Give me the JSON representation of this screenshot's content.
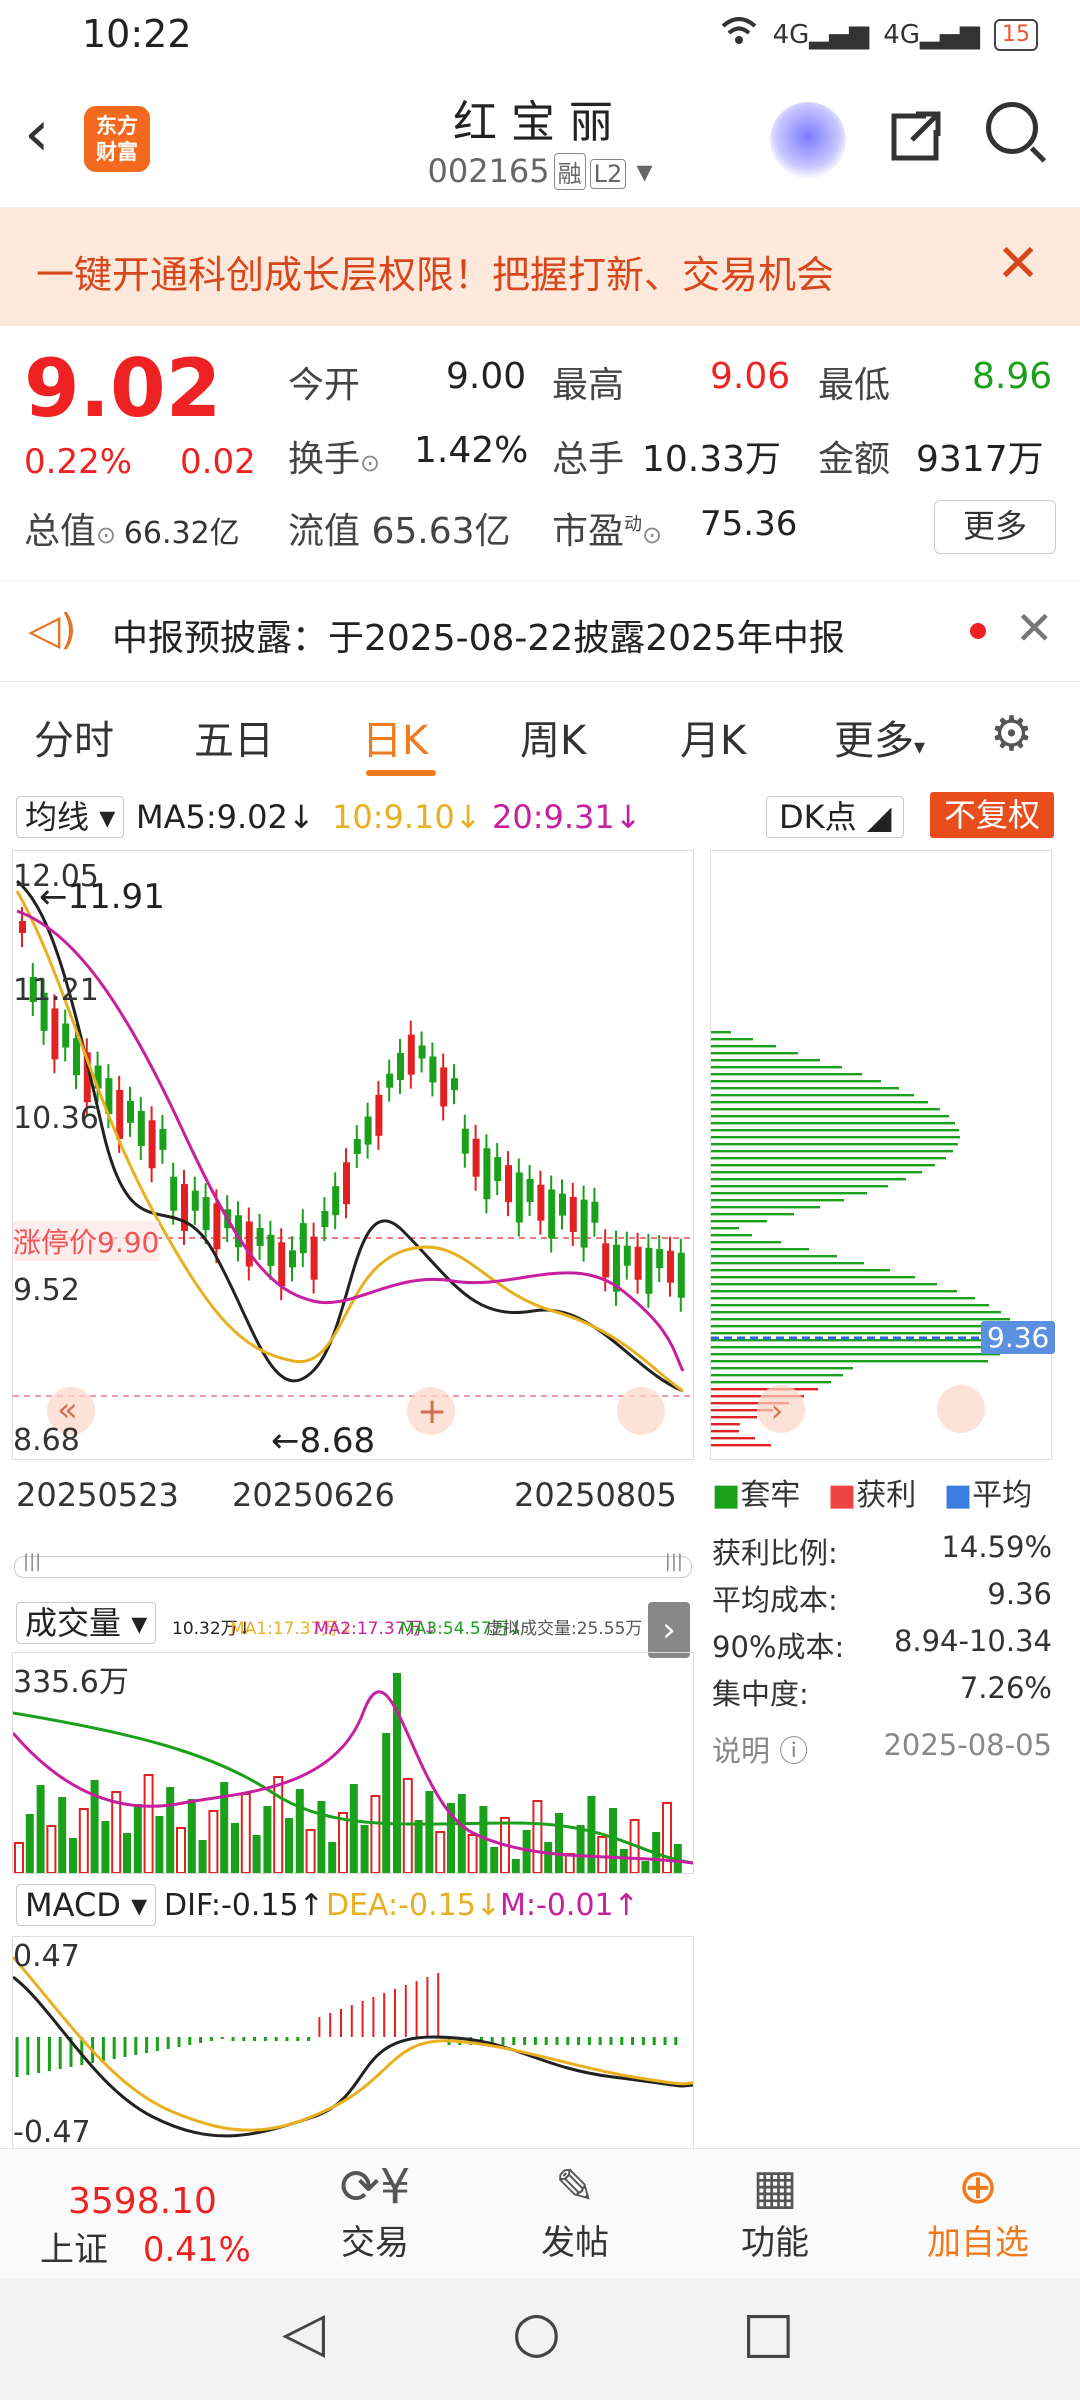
{
  "status": {
    "time": "10:22",
    "battery": "15",
    "signal1": "4G",
    "signal2": "4G"
  },
  "header": {
    "logo_line1": "东方",
    "logo_line2": "财富",
    "title": "红宝丽",
    "code": "002165",
    "tag1": "融",
    "tag2": "L2"
  },
  "banner": {
    "text": "一键开通科创成长层权限！把握打新、交易机会"
  },
  "quote": {
    "price": "9.02",
    "change_pct": "0.22%",
    "change": "0.02",
    "open_label": "今开",
    "open": "9.00",
    "high_label": "最高",
    "high": "9.06",
    "low_label": "最低",
    "low": "8.96",
    "turnover_label": "换手",
    "turnover": "1.42%",
    "volume_label": "总手",
    "volume": "10.33万",
    "amount_label": "金额",
    "amount": "9317万",
    "total_mv_label": "总值",
    "total_mv": "66.32亿",
    "float_mv_label": "流值",
    "float_mv": "65.63亿",
    "pe_label": "市盈",
    "pe_sup": "动",
    "pe": "75.36",
    "more": "更多"
  },
  "notice": {
    "text": "中报预披露：于2025-08-22披露2025年中报"
  },
  "tabs": [
    "分时",
    "五日",
    "日K",
    "周K",
    "月K",
    "更多"
  ],
  "ma": {
    "select": "均线",
    "ma5": "MA5:9.02↓",
    "ma10": "10:9.10↓",
    "ma20": "20:9.31↓",
    "dk": "DK点",
    "fq": "不复权"
  },
  "kchart": {
    "ymax": "12.05",
    "y2": "11.21",
    "y3": "10.36",
    "y4": "9.52",
    "ymin": "8.68",
    "high_mark": "←11.91",
    "low_mark": "←8.68",
    "limit_label": "涨停价9.90",
    "dates": [
      "20250523",
      "20250626",
      "20250805"
    ]
  },
  "chips": {
    "cost_badge": "9.36",
    "legend": [
      "套牢",
      "获利",
      "平均"
    ],
    "profit_ratio_label": "获利比例:",
    "profit_ratio": "14.59%",
    "avg_cost_label": "平均成本:",
    "avg_cost": "9.36",
    "cost90_label": "90%成本:",
    "cost90": "8.94-10.34",
    "conc_label": "集中度:",
    "conc": "7.26%",
    "note_label": "说明",
    "note_date": "2025-08-05"
  },
  "volume": {
    "select": "成交量",
    "v": "10.32万↓",
    "ma1": "MA1:17.37万↓",
    "ma2": "MA2:17.37万↓",
    "ma3": "MA3:54.57万↓",
    "virt": "虚拟成交量:25.55万",
    "ymax": "335.6万"
  },
  "macd": {
    "select": "MACD",
    "dif": "DIF:-0.15↑",
    "dea": "DEA:-0.15↓",
    "m": "M:-0.01↑",
    "ymax": "0.47",
    "ymin": "-0.47"
  },
  "bottom": {
    "index_value": "3598.10",
    "index_name": "上证",
    "index_pct": "0.41%",
    "trade": "交易",
    "post": "发帖",
    "func": "功能",
    "add": "加自选"
  },
  "colors": {
    "up": "#e22222",
    "down": "#1aa01a",
    "accent": "#f07a1c"
  }
}
